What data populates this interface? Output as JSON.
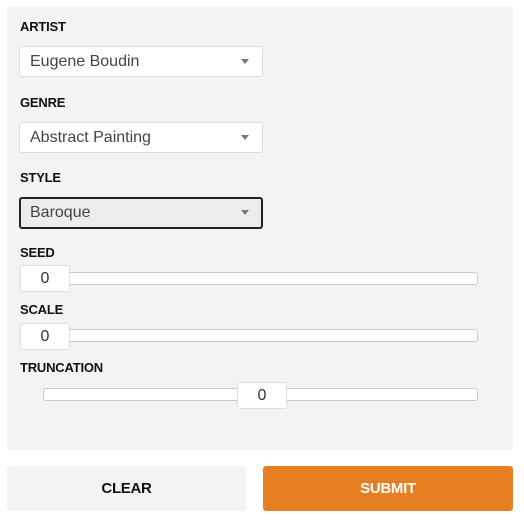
{
  "form": {
    "artist": {
      "label": "ARTIST",
      "value": "Eugene Boudin"
    },
    "genre": {
      "label": "GENRE",
      "value": "Abstract Painting"
    },
    "style": {
      "label": "STYLE",
      "value": "Baroque"
    },
    "seed": {
      "label": "SEED",
      "value": "0"
    },
    "scale": {
      "label": "SCALE",
      "value": "0"
    },
    "truncation": {
      "label": "TRUNCATION",
      "value": "0"
    }
  },
  "buttons": {
    "clear": "CLEAR",
    "submit": "SUBMIT"
  },
  "colors": {
    "accent": "#e67e22",
    "panel_bg": "#f3f3f3"
  }
}
